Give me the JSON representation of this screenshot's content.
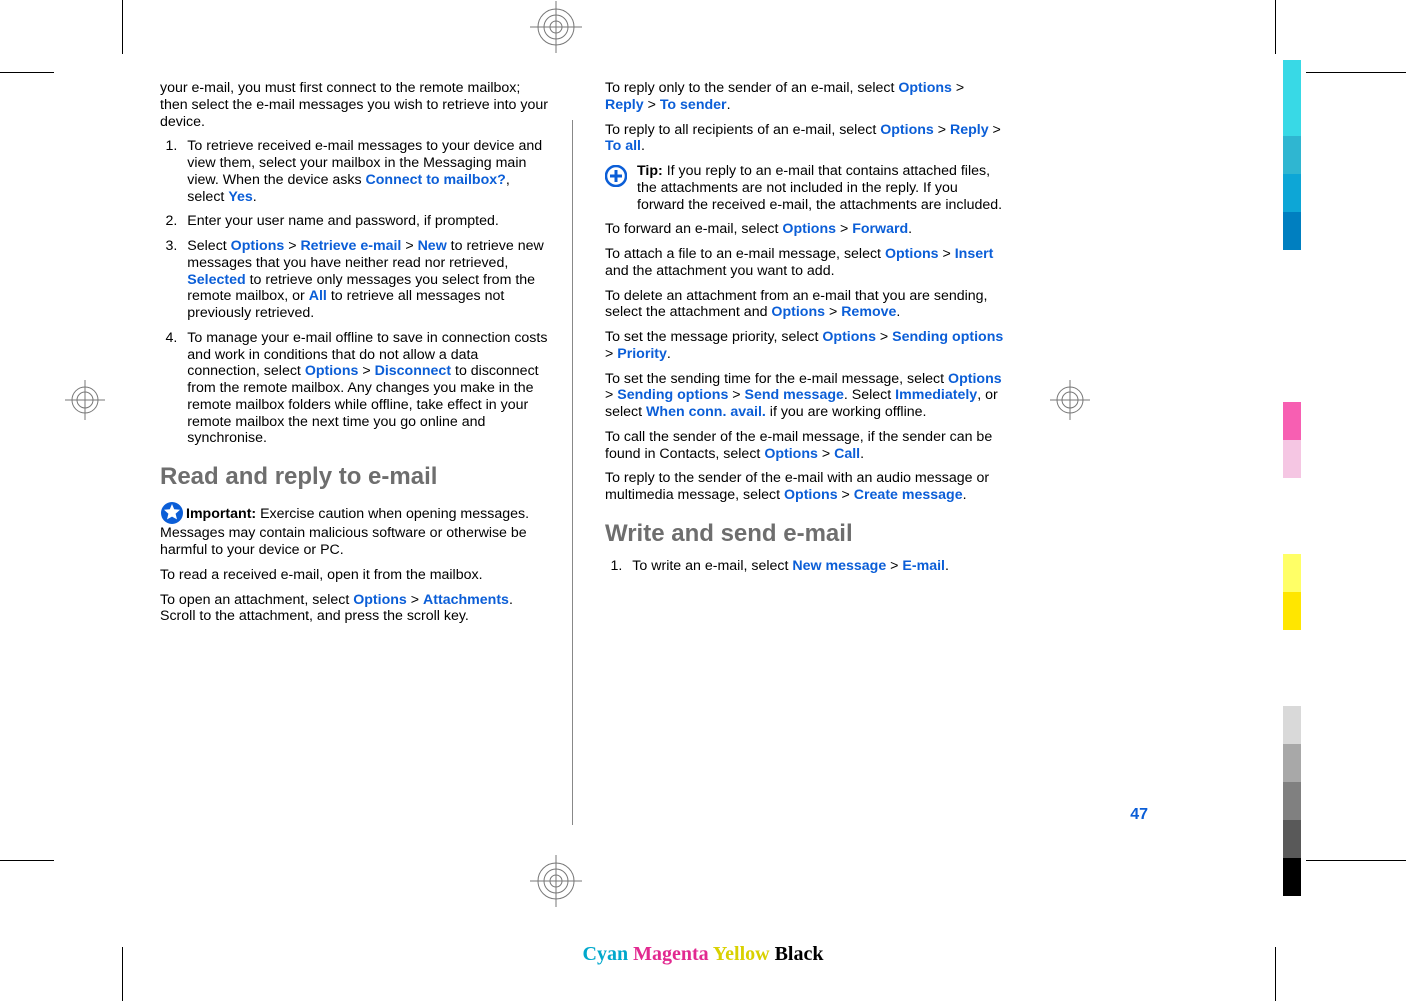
{
  "col1": {
    "intro": "your e-mail, you must first connect to the remote mailbox; then select the e-mail messages you wish to retrieve into your device.",
    "step1_a": "To retrieve received e-mail messages to your device and view them, select your mailbox in the Messaging main view. When the device asks ",
    "step1_link1": "Connect to mailbox?",
    "step1_b": ", select ",
    "step1_link2": "Yes",
    "step1_c": ".",
    "step2": "Enter your user name and password, if prompted.",
    "step3_a": "Select ",
    "step3_opt": "Options",
    "step3_gt1": "  >  ",
    "step3_ret": "Retrieve e-mail",
    "step3_gt2": "  >  ",
    "step3_new": "New",
    "step3_b": " to retrieve new messages that you have neither read nor retrieved, ",
    "step3_sel": "Selected",
    "step3_c": " to retrieve only messages you select from the remote mailbox, or ",
    "step3_all": "All",
    "step3_d": " to retrieve all messages not previously retrieved.",
    "step4_a": "To manage your e-mail offline to save in connection costs and work in conditions that do not allow a data connection, select ",
    "step4_opt": "Options",
    "step4_gt": "  >  ",
    "step4_disc": "Disconnect",
    "step4_b": " to disconnect from the remote mailbox. Any changes you make in the remote mailbox folders while offline, take effect in your remote mailbox the next time you go online and synchronise.",
    "heading1": "Read and reply to e-mail",
    "important_label": "Important: ",
    "important_text": "Exercise caution when opening messages. Messages may contain malicious software or otherwise be harmful to your device or PC.",
    "p_read": "To read a received e-mail, open it from the mailbox.",
    "p_open_a": "To open an attachment, select ",
    "p_open_opt": "Options",
    "p_open_gt": "  >  ",
    "p_open_att": "Attachments",
    "p_open_b": ". Scroll to the attachment, and press the scroll key."
  },
  "col2": {
    "reply1_a": "To reply only to the sender of an e-mail, select ",
    "reply1_opt": "Options",
    "reply1_gt1": "  >  ",
    "reply1_rep": "Reply",
    "reply1_gt2": "  >  ",
    "reply1_to": "To sender",
    "reply1_b": ".",
    "reply2_a": "To reply to all recipients of an e-mail, select ",
    "reply2_opt": "Options",
    "reply2_gt1": "  >  ",
    "reply2_rep": "Reply",
    "reply2_gt2": "  >  ",
    "reply2_to": "To all",
    "reply2_b": ".",
    "tip_label": "Tip: ",
    "tip_text": "If you reply to an e-mail that contains attached files, the attachments are not included in the reply. If you forward the received e-mail, the attachments are included.",
    "fwd_a": "To forward an e-mail, select ",
    "fwd_opt": "Options",
    "fwd_gt": "  >  ",
    "fwd_fwd": "Forward",
    "fwd_b": ".",
    "attach_a": "To attach a file to an e-mail message, select ",
    "attach_opt": "Options",
    "attach_gt": "  >  ",
    "attach_ins": "Insert",
    "attach_b": " and the attachment you want to add.",
    "del_a": "To delete an attachment from an e-mail that you are sending, select the attachment and ",
    "del_opt": "Options",
    "del_gt": "  >  ",
    "del_rem": "Remove",
    "del_b": ".",
    "prio_a": "To set the message priority, select ",
    "prio_opt": "Options",
    "prio_gt1": "  >  ",
    "prio_send": "Sending options",
    "prio_gt2": "  >  ",
    "prio_pri": "Priority",
    "prio_b": ".",
    "time_a": "To set the sending time for the e-mail message, select ",
    "time_opt": "Options",
    "time_gt1": "  >  ",
    "time_send": "Sending options",
    "time_gt2": "  >  ",
    "time_msg": "Send message",
    "time_b": ". Select ",
    "time_imm": "Immediately",
    "time_c": ", or select ",
    "time_when": "When conn. avail.",
    "time_d": " if you are working offline.",
    "call_a": "To call the sender of the e-mail message, if the sender can be found in Contacts, select ",
    "call_opt": "Options",
    "call_gt": "  >  ",
    "call_call": "Call",
    "call_b": ".",
    "audio_a": "To reply to the sender of the e-mail with an audio message or multimedia message, select ",
    "audio_opt": "Options",
    "audio_gt": "  >  ",
    "audio_cm": "Create message",
    "audio_b": ".",
    "heading2": "Write and send e-mail",
    "write1_a": "To write an e-mail, select ",
    "write1_new": "New message",
    "write1_gt": "  >  ",
    "write1_em": "E-mail",
    "write1_b": "."
  },
  "page_number": "47",
  "footer": {
    "cyan": "Cyan",
    "magenta": "Magenta",
    "yellow": "Yellow",
    "black": "Black"
  },
  "bars": [
    "#38d9e6",
    "#38d9e6",
    "#2fb6d1",
    "#0da6d6",
    "#007fc0",
    "",
    "",
    "",
    "#ffffff",
    "#f75fb2",
    "#f5c6e3",
    "",
    "",
    "#ffff66",
    "#ffe600",
    "",
    "",
    "#d9d9d9",
    "#a8a8a8",
    "#808080",
    "#595959",
    "#000000"
  ]
}
